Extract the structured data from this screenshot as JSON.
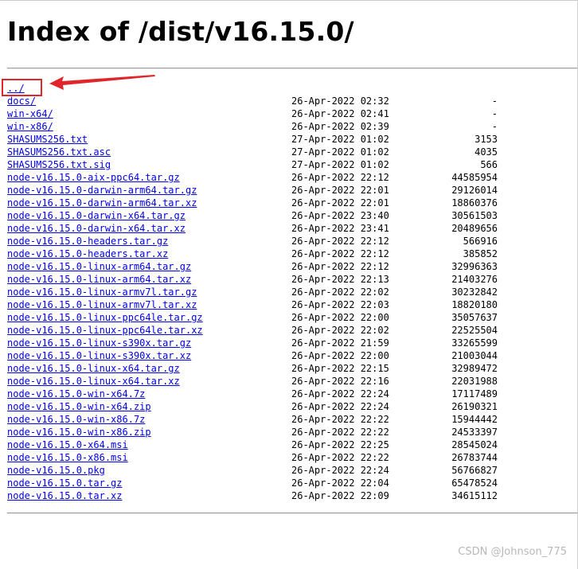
{
  "page": {
    "title": "Index of /dist/v16.15.0/"
  },
  "listing": [
    {
      "name": "../",
      "date": "",
      "size": ""
    },
    {
      "name": "docs/",
      "date": "26-Apr-2022 02:32",
      "size": "-"
    },
    {
      "name": "win-x64/",
      "date": "26-Apr-2022 02:41",
      "size": "-"
    },
    {
      "name": "win-x86/",
      "date": "26-Apr-2022 02:39",
      "size": "-"
    },
    {
      "name": "SHASUMS256.txt",
      "date": "27-Apr-2022 01:02",
      "size": "3153"
    },
    {
      "name": "SHASUMS256.txt.asc",
      "date": "27-Apr-2022 01:02",
      "size": "4035"
    },
    {
      "name": "SHASUMS256.txt.sig",
      "date": "27-Apr-2022 01:02",
      "size": "566"
    },
    {
      "name": "node-v16.15.0-aix-ppc64.tar.gz",
      "date": "26-Apr-2022 22:12",
      "size": "44585954"
    },
    {
      "name": "node-v16.15.0-darwin-arm64.tar.gz",
      "date": "26-Apr-2022 22:01",
      "size": "29126014"
    },
    {
      "name": "node-v16.15.0-darwin-arm64.tar.xz",
      "date": "26-Apr-2022 22:01",
      "size": "18860376"
    },
    {
      "name": "node-v16.15.0-darwin-x64.tar.gz",
      "date": "26-Apr-2022 23:40",
      "size": "30561503"
    },
    {
      "name": "node-v16.15.0-darwin-x64.tar.xz",
      "date": "26-Apr-2022 23:41",
      "size": "20489656"
    },
    {
      "name": "node-v16.15.0-headers.tar.gz",
      "date": "26-Apr-2022 22:12",
      "size": "566916"
    },
    {
      "name": "node-v16.15.0-headers.tar.xz",
      "date": "26-Apr-2022 22:12",
      "size": "385852"
    },
    {
      "name": "node-v16.15.0-linux-arm64.tar.gz",
      "date": "26-Apr-2022 22:12",
      "size": "32996363"
    },
    {
      "name": "node-v16.15.0-linux-arm64.tar.xz",
      "date": "26-Apr-2022 22:13",
      "size": "21403276"
    },
    {
      "name": "node-v16.15.0-linux-armv7l.tar.gz",
      "date": "26-Apr-2022 22:02",
      "size": "30232842"
    },
    {
      "name": "node-v16.15.0-linux-armv7l.tar.xz",
      "date": "26-Apr-2022 22:03",
      "size": "18820180"
    },
    {
      "name": "node-v16.15.0-linux-ppc64le.tar.gz",
      "date": "26-Apr-2022 22:00",
      "size": "35057637"
    },
    {
      "name": "node-v16.15.0-linux-ppc64le.tar.xz",
      "date": "26-Apr-2022 22:02",
      "size": "22525504"
    },
    {
      "name": "node-v16.15.0-linux-s390x.tar.gz",
      "date": "26-Apr-2022 21:59",
      "size": "33265599"
    },
    {
      "name": "node-v16.15.0-linux-s390x.tar.xz",
      "date": "26-Apr-2022 22:00",
      "size": "21003044"
    },
    {
      "name": "node-v16.15.0-linux-x64.tar.gz",
      "date": "26-Apr-2022 22:15",
      "size": "32989472"
    },
    {
      "name": "node-v16.15.0-linux-x64.tar.xz",
      "date": "26-Apr-2022 22:16",
      "size": "22031988"
    },
    {
      "name": "node-v16.15.0-win-x64.7z",
      "date": "26-Apr-2022 22:24",
      "size": "17117489"
    },
    {
      "name": "node-v16.15.0-win-x64.zip",
      "date": "26-Apr-2022 22:24",
      "size": "26190321"
    },
    {
      "name": "node-v16.15.0-win-x86.7z",
      "date": "26-Apr-2022 22:22",
      "size": "15944442"
    },
    {
      "name": "node-v16.15.0-win-x86.zip",
      "date": "26-Apr-2022 22:22",
      "size": "24533397"
    },
    {
      "name": "node-v16.15.0-x64.msi",
      "date": "26-Apr-2022 22:25",
      "size": "28545024"
    },
    {
      "name": "node-v16.15.0-x86.msi",
      "date": "26-Apr-2022 22:22",
      "size": "26783744"
    },
    {
      "name": "node-v16.15.0.pkg",
      "date": "26-Apr-2022 22:24",
      "size": "56766827"
    },
    {
      "name": "node-v16.15.0.tar.gz",
      "date": "26-Apr-2022 22:04",
      "size": "65478524"
    },
    {
      "name": "node-v16.15.0.tar.xz",
      "date": "26-Apr-2022 22:09",
      "size": "34615112"
    }
  ],
  "annotation": {
    "color": "#e0262a",
    "arrow_icon": "left-arrow-icon"
  },
  "watermark": {
    "text": "CSDN @Johnson_775"
  }
}
